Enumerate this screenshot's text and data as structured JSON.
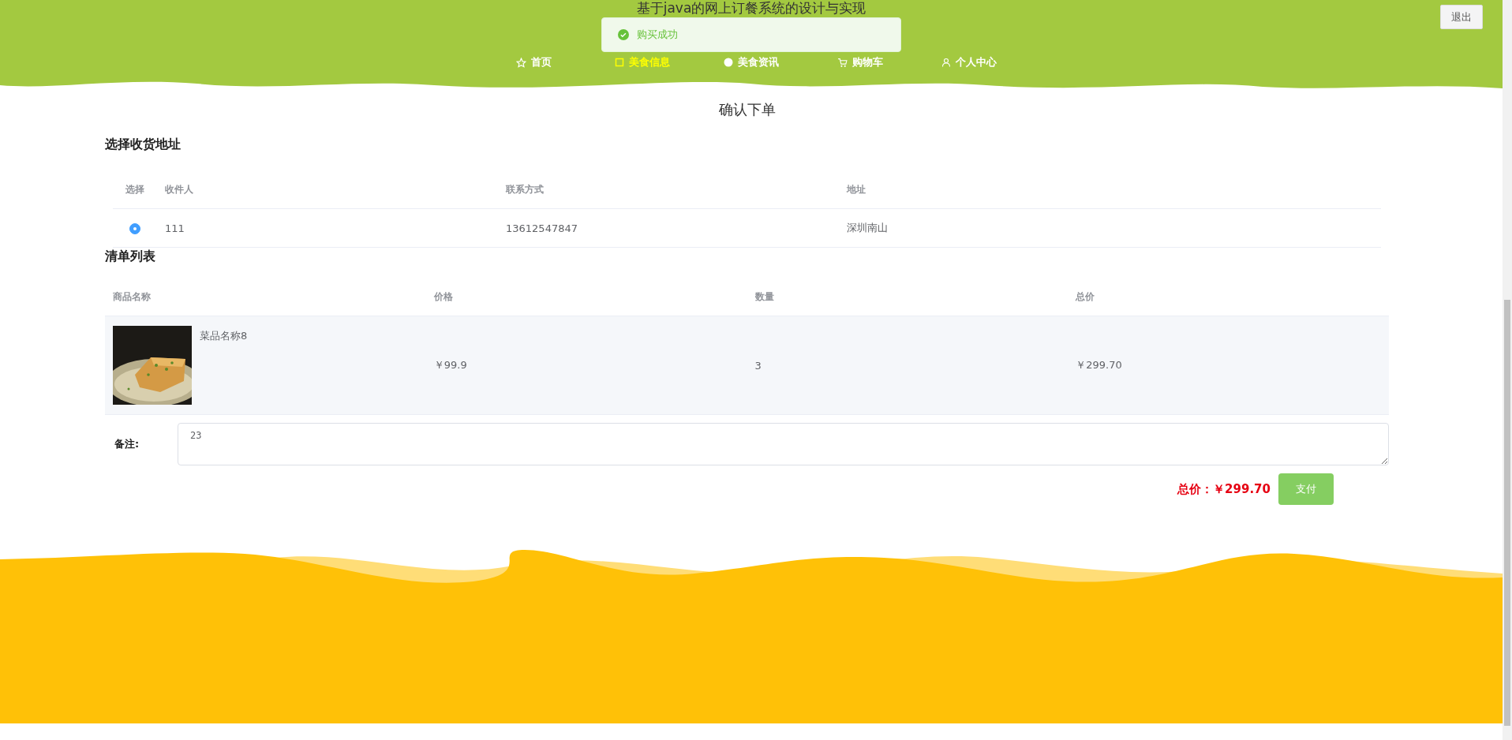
{
  "header": {
    "title": "基于java的网上订餐系统的设计与实现",
    "logout": "退出",
    "nav": [
      {
        "label": "首页",
        "selected": false
      },
      {
        "label": "美食信息",
        "selected": true
      },
      {
        "label": "美食资讯",
        "selected": false
      },
      {
        "label": "购物车",
        "selected": false
      },
      {
        "label": "个人中心",
        "selected": false
      }
    ]
  },
  "toast": {
    "message": "购买成功"
  },
  "page_title": "确认下单",
  "address_section": {
    "heading": "选择收货地址",
    "columns": [
      "选择",
      "收件人",
      "联系方式",
      "地址"
    ],
    "rows": [
      {
        "selected": true,
        "name": "111",
        "phone": "13612547847",
        "address": "深圳南山"
      }
    ]
  },
  "items_section": {
    "heading": "清单列表",
    "columns": [
      "商品名称",
      "价格",
      "数量",
      "总价"
    ],
    "rows": [
      {
        "name": "菜品名称8",
        "price": "￥99.9",
        "quantity": "3",
        "total": "￥299.70"
      }
    ]
  },
  "remark": {
    "label": "备注:",
    "value": "23"
  },
  "summary": {
    "total": "总价：￥299.70",
    "pay": "支付"
  }
}
